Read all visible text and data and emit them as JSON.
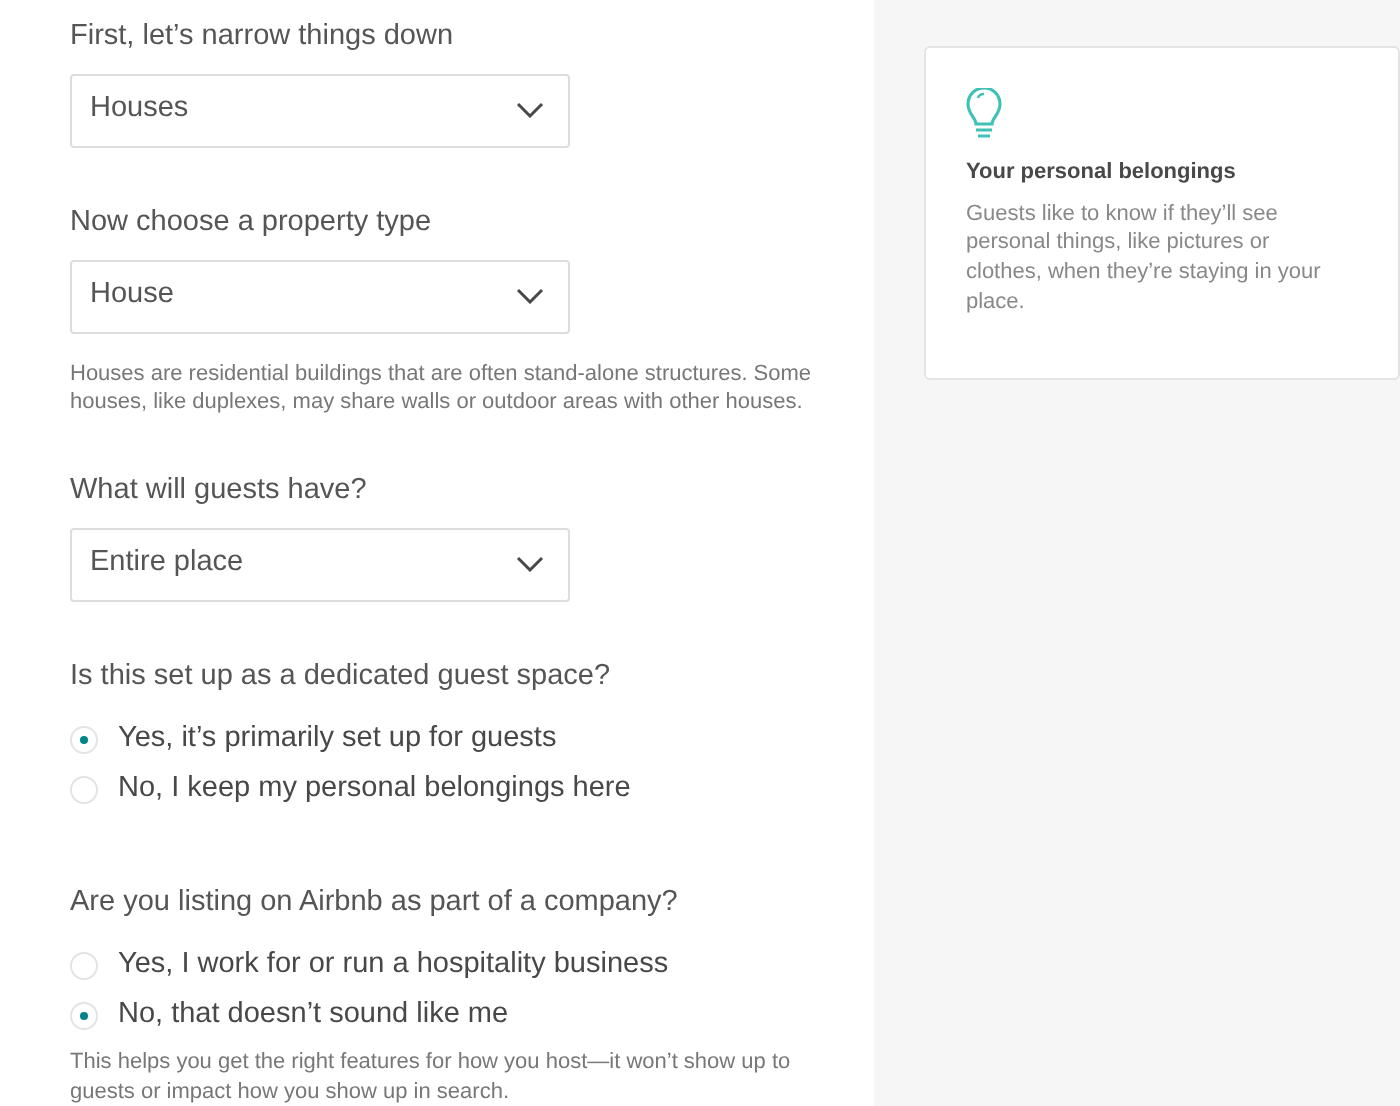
{
  "form": [
    {
      "kind": "select",
      "label": "First, let’s narrow things down",
      "value": "Houses"
    },
    {
      "kind": "select",
      "label": "Now choose a property type",
      "value": "House",
      "help": "Houses are residential buildings that are often stand-alone structures. Some houses, like duplexes, may share walls or outdoor areas with other houses."
    },
    {
      "kind": "select",
      "label": "What will guests have?",
      "value": "Entire place"
    },
    {
      "kind": "radio",
      "label": "Is this set up as a dedicated guest space?",
      "options": [
        {
          "label": "Yes, it’s primarily set up for guests",
          "selected": true
        },
        {
          "label": "No, I keep my personal belongings here",
          "selected": false
        }
      ]
    },
    {
      "kind": "radio",
      "label": "Are you listing on Airbnb as part of a company?",
      "options": [
        {
          "label": "Yes, I work for or run a hospitality business",
          "selected": false
        },
        {
          "label": "No, that doesn’t sound like me",
          "selected": true
        }
      ],
      "help": "This helps you get the right features for how you host—it won’t show up to guests or impact how you show up in search."
    }
  ],
  "tip": {
    "title": "Your personal belongings",
    "text": "Guests like to know if they’ll see personal things, like pictures or clothes, when they’re staying in your place."
  }
}
